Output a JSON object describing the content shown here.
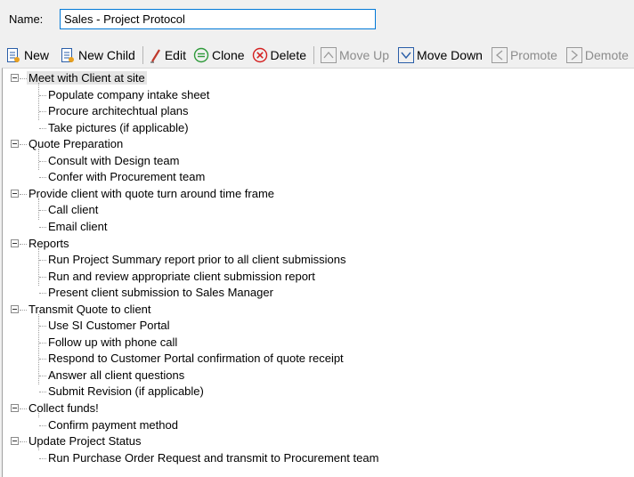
{
  "form": {
    "name_label": "Name:",
    "name_value": "Sales - Project Protocol"
  },
  "toolbar": {
    "new": "New",
    "new_child": "New Child",
    "edit": "Edit",
    "clone": "Clone",
    "delete": "Delete",
    "move_up": "Move Up",
    "move_down": "Move Down",
    "promote": "Promote",
    "demote": "Demote"
  },
  "tree": [
    {
      "label": "Meet with Client at site",
      "selected": true,
      "children": [
        "Populate company intake sheet",
        "Procure architechtual plans",
        "Take pictures (if applicable)"
      ]
    },
    {
      "label": "Quote Preparation",
      "children": [
        "Consult with Design team",
        "Confer with Procurement team"
      ]
    },
    {
      "label": "Provide client with quote turn around time frame",
      "children": [
        "Call client",
        "Email client"
      ]
    },
    {
      "label": "Reports",
      "children": [
        "Run Project Summary report prior to all client submissions",
        "Run and review appropriate client submission report",
        "Present client submission to Sales Manager"
      ]
    },
    {
      "label": "Transmit Quote to client",
      "children": [
        "Use SI Customer Portal",
        "Follow up with phone call",
        "Respond to Customer Portal confirmation of quote receipt",
        "Answer all client questions",
        "Submit Revision (if applicable)"
      ]
    },
    {
      "label": "Collect funds!",
      "children": [
        "Confirm payment method"
      ]
    },
    {
      "label": "Update Project Status",
      "children": [
        "Run Purchase Order Request and transmit to Procurement team"
      ]
    }
  ],
  "colors": {
    "accent": "#0078d7",
    "delete_red": "#d42020",
    "clone_green": "#2e9a3a"
  }
}
